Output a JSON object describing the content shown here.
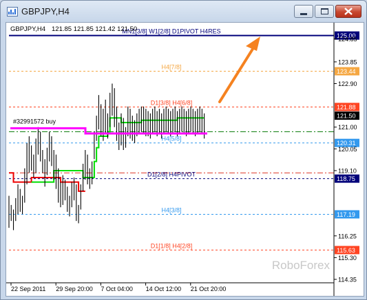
{
  "window": {
    "title": "GBPJPY,H4"
  },
  "chart_header": {
    "symbol_tf": "GBPJPY,H4",
    "ohlc": "121.85 121.85 121.42 121.50"
  },
  "brand": "RoboForex",
  "colors": {
    "price_line": "#000000",
    "supertrend_up": "#00dd00",
    "supertrend_down": "#ee0000",
    "order_line": "#ff00ff",
    "arrow": "#f58220",
    "current_price_label": "#000000"
  },
  "chart_data": {
    "type": "line",
    "title": "GBPJPY,H4",
    "xlabel": "",
    "ylabel": "",
    "ylim": [
      114.2,
      125.5
    ],
    "grid": false,
    "x_ticks": [
      {
        "label": "22 Sep 2011",
        "i": 0
      },
      {
        "label": "29 Sep 20:00",
        "i": 40
      },
      {
        "label": "7 Oct 04:00",
        "i": 80
      },
      {
        "label": "14 Oct 12:00",
        "i": 120
      },
      {
        "label": "21 Oct 20:00",
        "i": 160
      }
    ],
    "y_ticks": [
      124.85,
      123.85,
      122.9,
      121.0,
      120.05,
      119.1,
      116.25,
      115.3,
      114.35
    ],
    "levels": [
      {
        "label": "MN1[3/8] W1[2/8] D1PIVOT H4RES",
        "value": 125.0,
        "color": "#00007a",
        "style": "solid",
        "price_tag": "125.00"
      },
      {
        "label": "H4[7/8]",
        "value": 123.44,
        "color": "#f5a742",
        "style": "dash",
        "price_tag": "123.44"
      },
      {
        "label": "D1[3/8] H4[6/8]",
        "value": 121.88,
        "color": "#ff4422",
        "style": "dash",
        "price_tag": "121.88"
      },
      {
        "label": "",
        "value": 120.8,
        "color": "#007700",
        "style": "dashdot",
        "price_tag": ""
      },
      {
        "label": "H4[5/8]",
        "value": 120.31,
        "color": "#3399ee",
        "style": "dash",
        "price_tag": "120.31"
      },
      {
        "label": "",
        "value": 119.0,
        "color": "#dd3322",
        "style": "dashdot",
        "price_tag": ""
      },
      {
        "label": "D1[2/8] H4PIVOT",
        "value": 118.75,
        "color": "#00007a",
        "style": "dash",
        "price_tag": "118.75"
      },
      {
        "label": "H4[3/8]",
        "value": 117.19,
        "color": "#3399ee",
        "style": "dash",
        "price_tag": "117.19"
      },
      {
        "label": "D1[1/8] H4[2/8]",
        "value": 115.63,
        "color": "#ff4422",
        "style": "dash",
        "price_tag": "115.63"
      }
    ],
    "current_price": 121.5,
    "order": {
      "label": "#32991572 buy",
      "value": 120.72
    },
    "series": [
      {
        "kind": "ohlc_bars",
        "x": [
          0,
          2,
          4,
          6,
          8,
          10,
          12,
          14,
          16,
          18,
          20,
          22,
          24,
          26,
          28,
          30,
          32,
          34,
          36,
          38,
          40,
          42,
          44,
          46,
          48,
          50,
          52,
          54,
          56,
          58,
          60,
          62,
          64,
          66,
          68,
          70,
          72,
          74,
          76,
          78,
          80,
          82,
          84,
          86,
          88,
          90,
          92,
          94,
          96,
          98,
          100,
          102,
          104,
          106,
          108,
          110,
          112,
          114,
          116,
          118,
          120,
          122,
          124,
          126,
          128,
          130,
          132,
          134,
          136,
          138,
          140,
          142,
          144,
          146,
          148,
          150,
          152,
          154,
          156,
          158,
          160,
          162,
          164,
          166,
          168,
          170,
          172,
          174
        ],
        "high": [
          118.0,
          117.6,
          117.4,
          117.9,
          118.5,
          118.3,
          118.0,
          119.2,
          120.3,
          120.6,
          120.2,
          119.8,
          120.5,
          121.0,
          120.8,
          120.0,
          119.6,
          120.1,
          120.8,
          120.6,
          120.0,
          119.8,
          119.2,
          118.6,
          118.9,
          118.7,
          118.4,
          118.0,
          118.6,
          118.8,
          118.5,
          117.6,
          118.5,
          119.4,
          120.0,
          119.8,
          119.2,
          119.5,
          120.8,
          121.5,
          122.4,
          122.0,
          121.8,
          122.2,
          121.6,
          122.5,
          122.9,
          122.7,
          121.9,
          121.2,
          121.6,
          121.4,
          121.0,
          121.9,
          121.8,
          121.5,
          121.3,
          121.6,
          121.8,
          121.9,
          121.9,
          121.8,
          121.7,
          121.6,
          121.8,
          121.9,
          121.7,
          121.8,
          121.6,
          121.8,
          121.9,
          121.8,
          121.7,
          121.8,
          121.9,
          121.7,
          121.8,
          121.9,
          121.8,
          121.7,
          121.8,
          121.9,
          121.8,
          121.7,
          121.8,
          121.9,
          121.8,
          121.6
        ],
        "low": [
          116.6,
          116.9,
          116.5,
          116.9,
          117.2,
          117.3,
          117.2,
          117.7,
          118.5,
          119.0,
          119.1,
          118.8,
          119.0,
          119.8,
          119.5,
          119.0,
          118.4,
          118.9,
          119.5,
          119.3,
          118.7,
          118.3,
          117.7,
          117.5,
          117.6,
          117.8,
          117.3,
          117.1,
          117.5,
          117.8,
          116.9,
          116.8,
          117.4,
          118.2,
          118.7,
          118.5,
          118.3,
          118.5,
          119.6,
          120.4,
          120.9,
          120.6,
          120.4,
          120.7,
          120.5,
          121.0,
          121.5,
          121.0,
          120.4,
          120.0,
          120.2,
          120.0,
          120.1,
          120.6,
          120.5,
          120.4,
          120.3,
          120.6,
          120.7,
          120.8,
          120.7,
          120.6,
          120.6,
          120.5,
          120.7,
          120.8,
          120.6,
          120.7,
          120.5,
          120.7,
          120.8,
          120.7,
          120.6,
          120.7,
          120.8,
          120.6,
          120.7,
          120.8,
          120.7,
          120.6,
          120.7,
          120.8,
          120.7,
          120.6,
          120.7,
          120.8,
          120.7,
          120.5
        ]
      },
      {
        "kind": "supertrend",
        "segments": [
          {
            "color": "#ee0000",
            "points": [
              [
                0,
                119.0
              ],
              [
                4,
                118.6
              ],
              [
                10,
                118.6
              ],
              [
                20,
                118.8
              ],
              [
                44,
                118.8
              ],
              [
                46,
                118.6
              ],
              [
                58,
                118.6
              ],
              [
                62,
                118.2
              ],
              [
                68,
                118.2
              ]
            ]
          },
          {
            "color": "#00dd00",
            "points": [
              [
                20,
                118.6
              ],
              [
                40,
                119.1
              ],
              [
                60,
                119.1
              ],
              [
                66,
                118.8
              ],
              [
                72,
                118.8
              ],
              [
                76,
                119.5
              ],
              [
                78,
                120.1
              ],
              [
                80,
                120.6
              ],
              [
                88,
                120.8
              ],
              [
                90,
                121.4
              ],
              [
                96,
                121.4
              ],
              [
                100,
                121.2
              ],
              [
                118,
                121.3
              ],
              [
                140,
                121.3
              ],
              [
                150,
                121.4
              ],
              [
                174,
                121.4
              ]
            ]
          }
        ]
      }
    ]
  }
}
